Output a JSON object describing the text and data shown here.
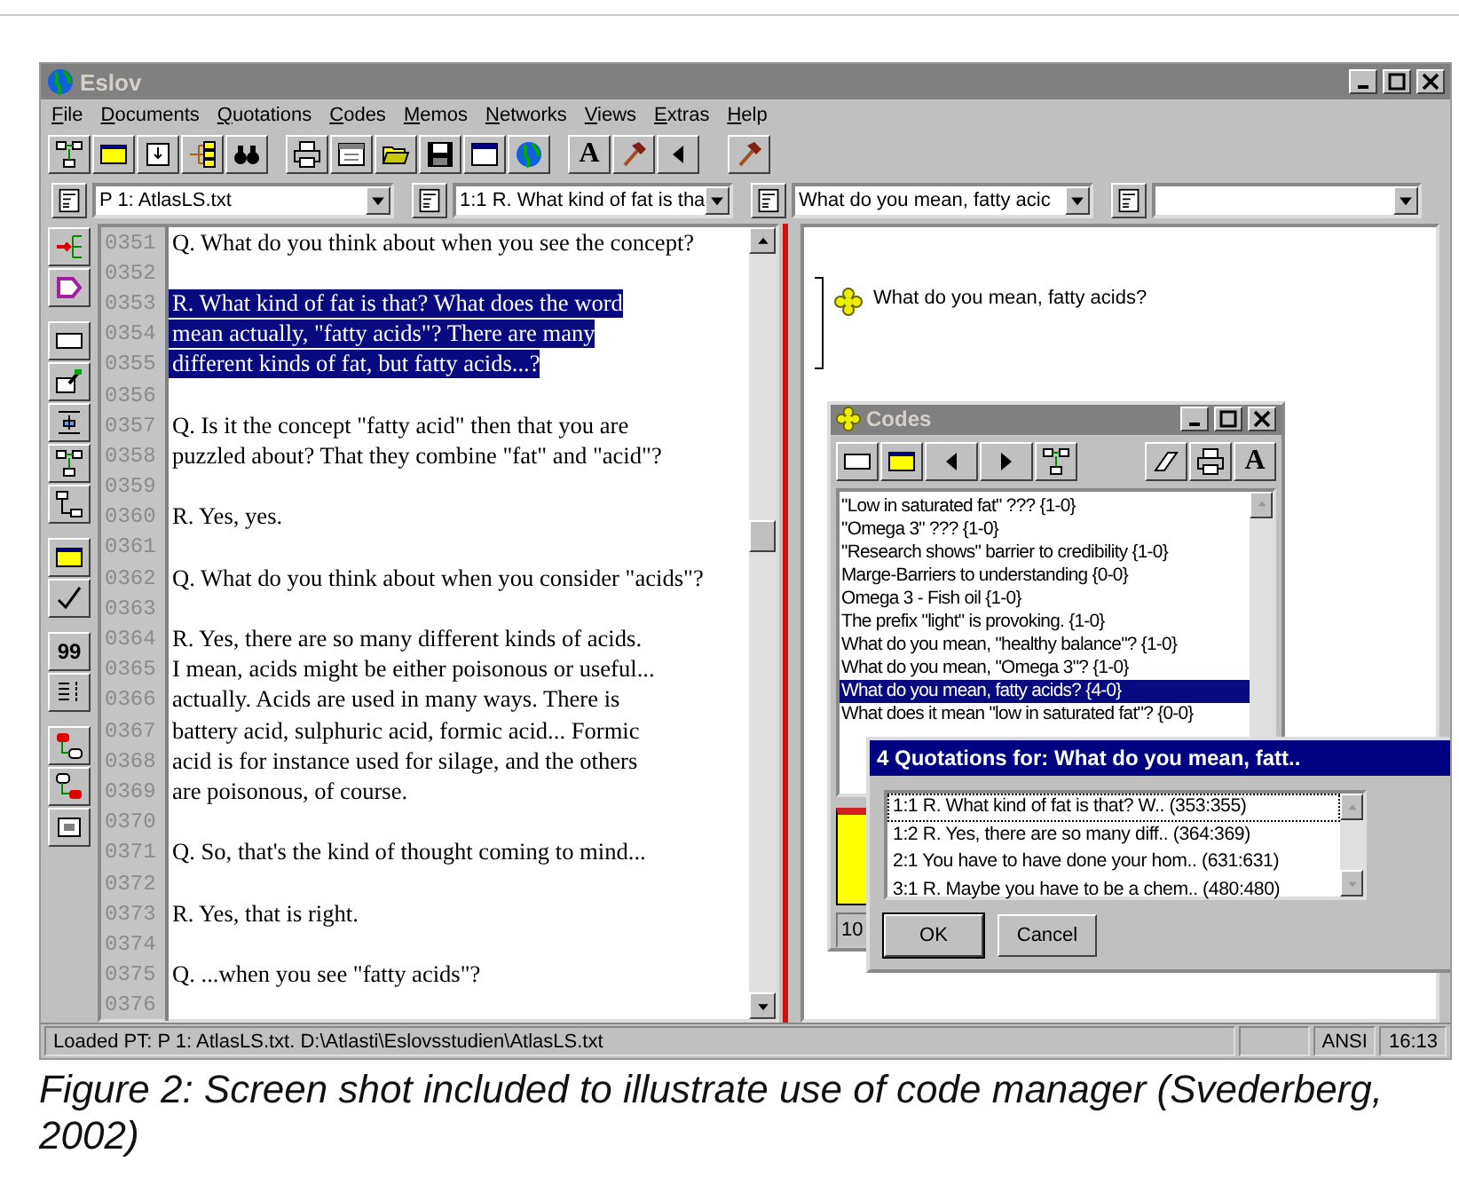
{
  "window": {
    "title": "Eslov"
  },
  "menu": [
    {
      "label": "File"
    },
    {
      "label": "Documents"
    },
    {
      "label": "Quotations"
    },
    {
      "label": "Codes"
    },
    {
      "label": "Memos"
    },
    {
      "label": "Networks"
    },
    {
      "label": "Views"
    },
    {
      "label": "Extras"
    },
    {
      "label": "Help"
    }
  ],
  "toolbar": {
    "font_button": "A"
  },
  "combos": [
    {
      "value": "P 1: AtlasLS.txt"
    },
    {
      "value": "1:1 R. What kind of fat is tha"
    },
    {
      "value": "What do you mean, fatty acic"
    }
  ],
  "side_toolbar": {
    "quote_button": "99"
  },
  "document": {
    "lines": [
      {
        "number": "0351",
        "text": "Q. What do you think about when you see the concept?",
        "selected": false
      },
      {
        "number": "0352"
      },
      {
        "number": "0353",
        "text": "R. What kind of fat is that? What does the word",
        "selected": true
      },
      {
        "number": "0354",
        "text": "mean actually, \"fatty acids\"? There are many",
        "selected": true
      },
      {
        "number": "0355",
        "text": "different kinds of fat, but fatty acids...?",
        "selected": true
      },
      {
        "number": "0356"
      },
      {
        "number": "0357",
        "text": "Q. Is it the concept \"fatty acid\" then that you are",
        "selected": false
      },
      {
        "number": "0358",
        "text": "puzzled about? That they combine \"fat\" and \"acid\"?",
        "selected": false
      },
      {
        "number": "0359"
      },
      {
        "number": "0360",
        "text": "R. Yes, yes.",
        "selected": false
      },
      {
        "number": "0361"
      },
      {
        "number": "0362",
        "text": "Q. What do you think about when you consider \"acids\"?",
        "selected": false
      },
      {
        "number": "0363"
      },
      {
        "number": "0364",
        "text": "R. Yes, there are so many different kinds of acids.",
        "selected": false
      },
      {
        "number": "0365",
        "text": "I mean, acids might be either poisonous or useful...",
        "selected": false
      },
      {
        "number": "0366",
        "text": "actually. Acids are used in many ways. There is",
        "selected": false
      },
      {
        "number": "0367",
        "text": "battery acid, sulphuric acid, formic acid... Formic",
        "selected": false
      },
      {
        "number": "0368",
        "text": "acid is for instance used for silage, and the others",
        "selected": false
      },
      {
        "number": "0369",
        "text": "are poisonous, of course.",
        "selected": false
      },
      {
        "number": "0370"
      },
      {
        "number": "0371",
        "text": "Q. So, that's the kind of thought coming to mind...",
        "selected": false
      },
      {
        "number": "0372"
      },
      {
        "number": "0373",
        "text": "R. Yes, that is right.",
        "selected": false
      },
      {
        "number": "0374"
      },
      {
        "number": "0375",
        "text": "Q. ...when you see \"fatty acids\"?",
        "selected": false
      },
      {
        "number": "0376"
      }
    ]
  },
  "margin": {
    "code": "What do you mean, fatty acids?"
  },
  "codes_window": {
    "title": "Codes",
    "font_button": "A",
    "counter": "10",
    "items": [
      {
        "label": "\"Low in saturated fat\" ??? {1-0}",
        "selected": false
      },
      {
        "label": "\"Omega 3\" ??? {1-0}",
        "selected": false
      },
      {
        "label": "\"Research shows\" barrier to credibility {1-0}",
        "selected": false
      },
      {
        "label": "Marge-Barriers to understanding {0-0}",
        "selected": false
      },
      {
        "label": "Omega 3 - Fish oil {1-0}",
        "selected": false
      },
      {
        "label": "The prefix \"light\" is provoking. {1-0}",
        "selected": false
      },
      {
        "label": "What do you  mean, \"healthy balance\"? {1-0}",
        "selected": false
      },
      {
        "label": "What do you mean, \"Omega 3\"? {1-0}",
        "selected": false
      },
      {
        "label": "What do you mean, fatty acids? {4-0}",
        "selected": true
      },
      {
        "label": "What does it mean \"low in saturated fat\"? {0-0}",
        "selected": false
      }
    ]
  },
  "quotations_dialog": {
    "title": "4 Quotations for: What do you mean, fatt..",
    "items": [
      {
        "label": "1:1 R. What kind of fat is that? W.. (353:355)",
        "focused": true
      },
      {
        "label": "1:2 R. Yes, there are so many diff.. (364:369)",
        "focused": false
      },
      {
        "label": "2:1 You have to have done your hom.. (631:631)",
        "focused": false
      },
      {
        "label": "3:1 R. Maybe you have to be a chem.. (480:480)",
        "focused": false
      }
    ],
    "buttons": [
      {
        "label": "OK",
        "default": true
      },
      {
        "label": "Cancel",
        "default": false
      }
    ]
  },
  "status_bar": {
    "message": "Loaded PT: P 1: AtlasLS.txt. D:\\Atlasti\\Eslovsstudien\\AtlasLS.txt",
    "encoding": "ANSI",
    "time": "16:13"
  },
  "caption": "Figure 2: Screen shot included to illustrate use of code manager (Svederberg, 2002)"
}
